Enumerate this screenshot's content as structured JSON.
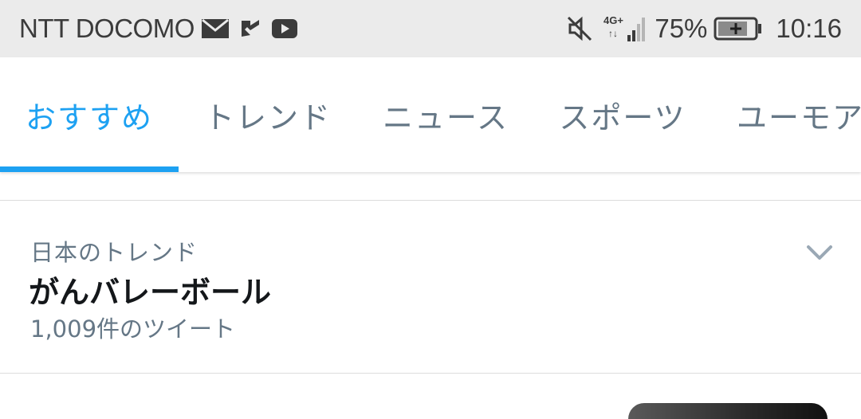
{
  "status_bar": {
    "carrier": "NTT DOCOMO",
    "left_icons": [
      "mail-icon",
      "check-badge-icon",
      "youtube-icon"
    ],
    "right_icons": [
      "mute-icon",
      "4g-signal-icon",
      "battery-charging-icon"
    ],
    "network_label": "4G+",
    "battery_percent": "75%",
    "time": "10:16"
  },
  "tabs": [
    {
      "label": "おすすめ",
      "active": true
    },
    {
      "label": "トレンド",
      "active": false
    },
    {
      "label": "ニュース",
      "active": false
    },
    {
      "label": "スポーツ",
      "active": false
    },
    {
      "label": "ユーモア",
      "active": false
    }
  ],
  "trend": {
    "context": "日本のトレンド",
    "title": "がんバレーボール",
    "tweet_count": "1,009件のツイート"
  },
  "colors": {
    "accent": "#1da1f2",
    "text_primary": "#14171a",
    "text_secondary": "#657786",
    "status_bar_bg": "#ebebeb"
  }
}
